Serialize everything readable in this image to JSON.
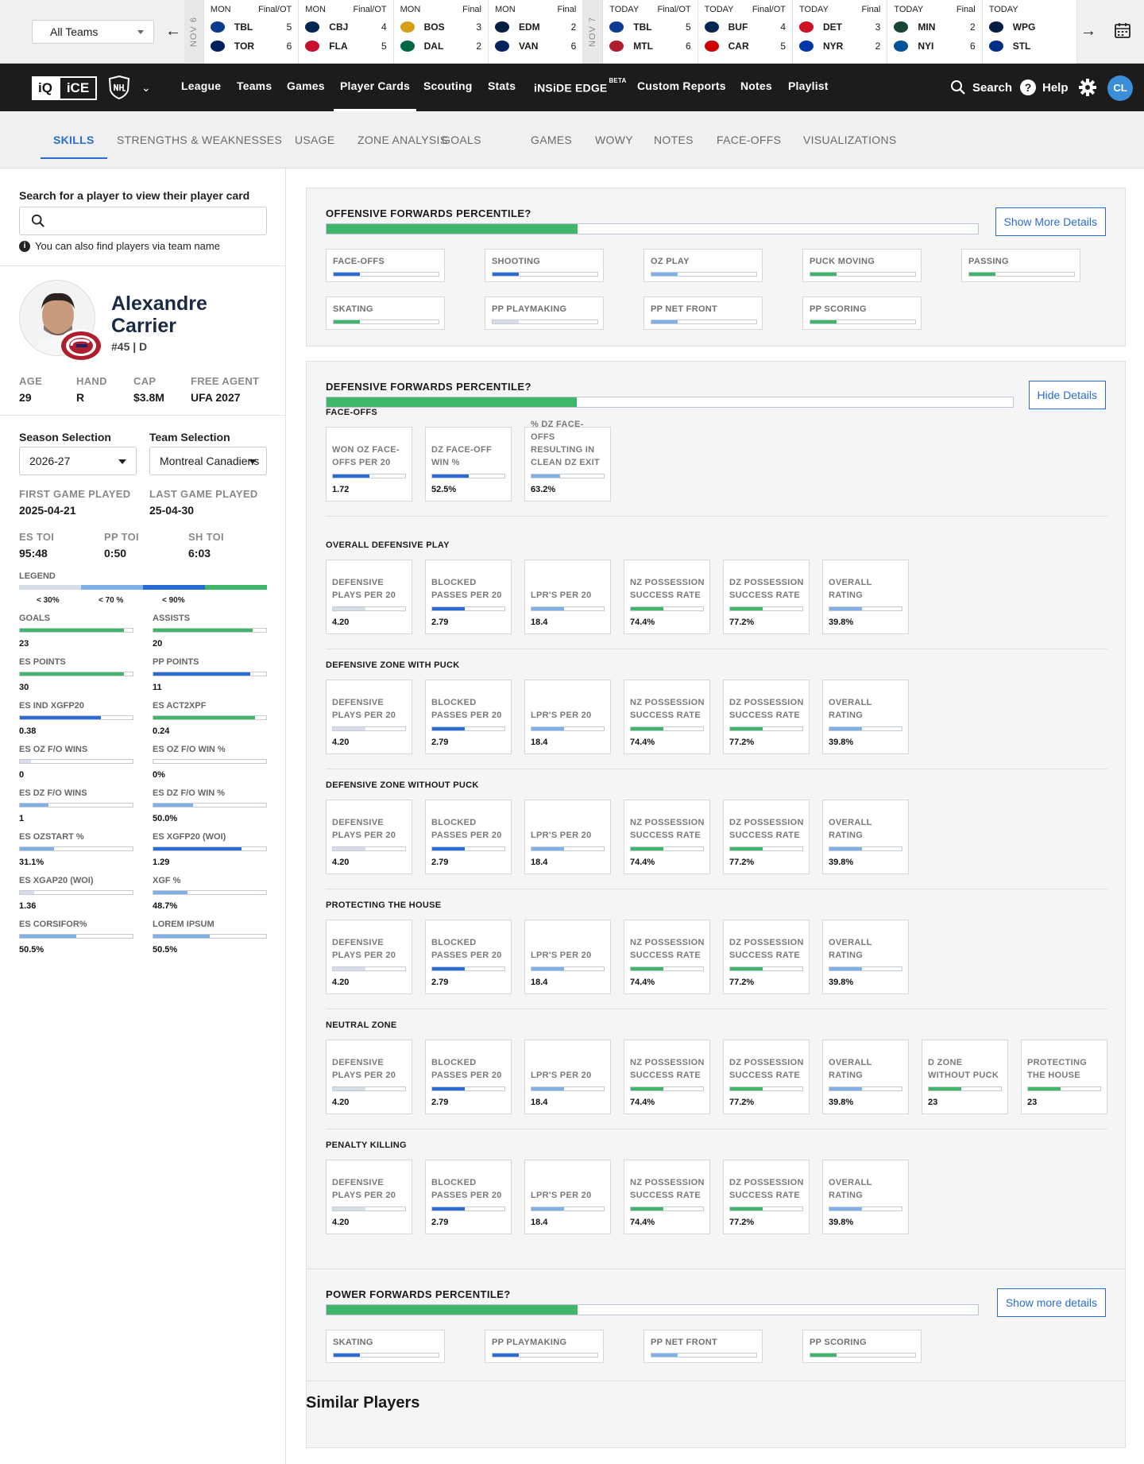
{
  "scoreboard": {
    "team_filter": "All Teams",
    "dates": [
      "NOV 6",
      "NOV 7"
    ],
    "games": [
      {
        "day": "MON",
        "status": "Final/OT",
        "t1": "TBL",
        "s1": "5",
        "t2": "TOR",
        "s2": "6",
        "c1": "#0b3b8c",
        "c2": "#00205b"
      },
      {
        "day": "MON",
        "status": "Final/OT",
        "t1": "CBJ",
        "s1": "4",
        "t2": "FLA",
        "s2": "5",
        "c1": "#002654",
        "c2": "#c8102e"
      },
      {
        "day": "MON",
        "status": "Final",
        "t1": "BOS",
        "s1": "3",
        "t2": "DAL",
        "s2": "2",
        "c1": "#d4a017",
        "c2": "#006847"
      },
      {
        "day": "MON",
        "status": "Final",
        "t1": "EDM",
        "s1": "2",
        "t2": "VAN",
        "s2": "6",
        "c1": "#041e42",
        "c2": "#00205b"
      },
      {
        "day": "TODAY",
        "status": "Final/OT",
        "t1": "TBL",
        "s1": "5",
        "t2": "MTL",
        "s2": "6",
        "c1": "#0b3b8c",
        "c2": "#af1e2d"
      },
      {
        "day": "TODAY",
        "status": "Final/OT",
        "t1": "BUF",
        "s1": "4",
        "t2": "CAR",
        "s2": "5",
        "c1": "#002654",
        "c2": "#cc0000"
      },
      {
        "day": "TODAY",
        "status": "Final",
        "t1": "DET",
        "s1": "3",
        "t2": "NYR",
        "s2": "2",
        "c1": "#ce1126",
        "c2": "#0038a8"
      },
      {
        "day": "TODAY",
        "status": "Final",
        "t1": "MIN",
        "s1": "2",
        "t2": "NYI",
        "s2": "6",
        "c1": "#154734",
        "c2": "#00539b"
      },
      {
        "day": "TODAY",
        "status": "",
        "t1": "WPG",
        "s1": "",
        "t2": "STL",
        "s2": "",
        "c1": "#041e42",
        "c2": "#002f87"
      }
    ]
  },
  "nav": {
    "logo_iq": "iQ",
    "logo_ice": "iCE",
    "items": [
      "League",
      "Teams",
      "Games",
      "Player Cards",
      "Scouting",
      "Stats",
      "iNSiDE EDGE",
      "Custom Reports",
      "Notes",
      "Playlist"
    ],
    "beta": "BETA",
    "search": "Search",
    "help": "Help",
    "avatar": "CL"
  },
  "subtabs": [
    "SKILLS",
    "STRENGTHS & WEAKNESSES",
    "USAGE",
    "ZONE ANALYSIS",
    "GOALS",
    "GAMES",
    "WOWY",
    "NOTES",
    "FACE-OFFS",
    "VISUALIZATIONS"
  ],
  "sidebar": {
    "search_label": "Search for a player to view their player card",
    "search_hint": "You can also find players via team name",
    "player_first": "Alexandre",
    "player_last": "Carrier",
    "number_pos": "#45 | D",
    "bio": [
      {
        "l": "AGE",
        "v": "29"
      },
      {
        "l": "HAND",
        "v": "R"
      },
      {
        "l": "CAP",
        "v": "$3.8M"
      },
      {
        "l": "FREE AGENT",
        "v": "UFA 2027"
      }
    ],
    "season_label": "Season Selection",
    "season": "2026-27",
    "team_label": "Team Selection",
    "team": "Montreal Canadiens",
    "first_label": "FIRST GAME PLAYED",
    "first": "2025-04-21",
    "last_label": "LAST GAME PLAYED",
    "last": "25-04-30",
    "toi": [
      {
        "l": "ES TOI",
        "v": "95:48"
      },
      {
        "l": "PP TOI",
        "v": "0:50"
      },
      {
        "l": "SH TOI",
        "v": "6:03"
      }
    ],
    "legend_label": "LEGEND",
    "legend": [
      "< 30%",
      "< 70 %",
      "< 90%"
    ],
    "stats": [
      {
        "l": "GOALS",
        "v": "23",
        "p": 0.92,
        "c": "#3fb66a"
      },
      {
        "l": "ASSISTS",
        "v": "20",
        "p": 0.88,
        "c": "#3fb66a"
      },
      {
        "l": "ES POINTS",
        "v": "30",
        "p": 0.92,
        "c": "#3fb66a"
      },
      {
        "l": "PP POINTS",
        "v": "11",
        "p": 0.86,
        "c": "#2a6bd4"
      },
      {
        "l": "ES IND XGFP20",
        "v": "0.38",
        "p": 0.72,
        "c": "#2a6bd4"
      },
      {
        "l": "ES ACT2XPF",
        "v": "0.24",
        "p": 0.9,
        "c": "#3fb66a"
      },
      {
        "l": "ES OZ F/O WINS",
        "v": "0",
        "p": 0.1,
        "c": "#d6dde8"
      },
      {
        "l": "ES OZ F/O WIN %",
        "v": "0%",
        "p": 0.0,
        "c": "#d6dde8"
      },
      {
        "l": "ES DZ F/O WINS",
        "v": "1",
        "p": 0.25,
        "c": "#7fb0e8"
      },
      {
        "l": "ES DZ F/O WIN %",
        "v": "50.0%",
        "p": 0.35,
        "c": "#7fb0e8"
      },
      {
        "l": "ES OZSTART %",
        "v": "31.1%",
        "p": 0.3,
        "c": "#7fb0e8"
      },
      {
        "l": "ES XGFP20 (WOI)",
        "v": "1.29",
        "p": 0.78,
        "c": "#2a6bd4"
      },
      {
        "l": "ES XGAP20 (WOI)",
        "v": "1.36",
        "p": 0.13,
        "c": "#d6dde8"
      },
      {
        "l": "XGF %",
        "v": "48.7%",
        "p": 0.3,
        "c": "#7fb0e8"
      },
      {
        "l": "ES CORSIFOR%",
        "v": "50.5%",
        "p": 0.5,
        "c": "#7fb0e8"
      },
      {
        "l": "LOREM IPSUM",
        "v": "50.5%",
        "p": 0.5,
        "c": "#7fb0e8"
      }
    ]
  },
  "panels": {
    "offensive": {
      "title": "OFFENSIVE FORWARDS PERCENTILE?",
      "pct": 0.385,
      "button": "Show More Details",
      "chips": [
        {
          "l": "FACE-OFFS",
          "p": 0.25,
          "c": "#2a6bd4"
        },
        {
          "l": "SHOOTING",
          "p": 0.25,
          "c": "#2a6bd4"
        },
        {
          "l": "OZ PLAY",
          "p": 0.25,
          "c": "#7fb0e8"
        },
        {
          "l": "PUCK MOVING",
          "p": 0.25,
          "c": "#3fb66a"
        },
        {
          "l": "PASSING",
          "p": 0.25,
          "c": "#3fb66a"
        },
        {
          "l": "SKATING",
          "p": 0.25,
          "c": "#3fb66a"
        },
        {
          "l": "PP PLAYMAKING",
          "p": 0.25,
          "c": "#d6dde8"
        },
        {
          "l": "PP NET FRONT",
          "p": 0.25,
          "c": "#7fb0e8"
        },
        {
          "l": "PP SCORING",
          "p": 0.25,
          "c": "#3fb66a"
        }
      ]
    },
    "defensive": {
      "title": "DEFENSIVE FORWARDS PERCENTILE?",
      "pct": 0.365,
      "button": "Hide Details",
      "sections": [
        {
          "title": "FACE-OFFS",
          "cards": [
            {
              "l": "WON OZ FACE-OFFS PER 20",
              "v": "1.72",
              "p": 0.5,
              "c": "#2a6bd4"
            },
            {
              "l": "DZ FACE-OFF WIN %",
              "v": "52.5%",
              "p": 0.5,
              "c": "#2a6bd4"
            },
            {
              "l": "% DZ FACE-OFFS RESULTING IN CLEAN DZ EXIT",
              "v": "63.2%",
              "p": 0.4,
              "c": "#7fb0e8"
            }
          ]
        },
        {
          "title": "OVERALL DEFENSIVE PLAY",
          "cards": [
            {
              "l": "DEFENSIVE PLAYS PER 20",
              "v": "4.20",
              "p": 0.45,
              "c": "#d6dde8"
            },
            {
              "l": "BLOCKED PASSES PER 20",
              "v": "2.79",
              "p": 0.45,
              "c": "#2a6bd4"
            },
            {
              "l": "LPR'S PER 20",
              "v": "18.4",
              "p": 0.45,
              "c": "#7fb0e8"
            },
            {
              "l": "NZ POSSESSION SUCCESS RATE",
              "v": "74.4%",
              "p": 0.45,
              "c": "#3fb66a"
            },
            {
              "l": "DZ POSSESSION SUCCESS RATE",
              "v": "77.2%",
              "p": 0.45,
              "c": "#3fb66a"
            },
            {
              "l": "OVERALL RATING",
              "v": "39.8%",
              "p": 0.45,
              "c": "#7fb0e8"
            }
          ]
        },
        {
          "title": "DEFENSIVE ZONE WITH PUCK",
          "cards": [
            {
              "l": "DEFENSIVE PLAYS PER 20",
              "v": "4.20",
              "p": 0.45,
              "c": "#d6dde8"
            },
            {
              "l": "BLOCKED PASSES PER 20",
              "v": "2.79",
              "p": 0.45,
              "c": "#2a6bd4"
            },
            {
              "l": "LPR'S PER 20",
              "v": "18.4",
              "p": 0.45,
              "c": "#7fb0e8"
            },
            {
              "l": "NZ POSSESSION SUCCESS RATE",
              "v": "74.4%",
              "p": 0.45,
              "c": "#3fb66a"
            },
            {
              "l": "DZ POSSESSION SUCCESS RATE",
              "v": "77.2%",
              "p": 0.45,
              "c": "#3fb66a"
            },
            {
              "l": "OVERALL RATING",
              "v": "39.8%",
              "p": 0.45,
              "c": "#7fb0e8"
            }
          ]
        },
        {
          "title": "DEFENSIVE ZONE WITHOUT PUCK",
          "cards": [
            {
              "l": "DEFENSIVE PLAYS PER 20",
              "v": "4.20",
              "p": 0.45,
              "c": "#d6dde8"
            },
            {
              "l": "BLOCKED PASSES PER 20",
              "v": "2.79",
              "p": 0.45,
              "c": "#2a6bd4"
            },
            {
              "l": "LPR'S PER 20",
              "v": "18.4",
              "p": 0.45,
              "c": "#7fb0e8"
            },
            {
              "l": "NZ POSSESSION SUCCESS RATE",
              "v": "74.4%",
              "p": 0.45,
              "c": "#3fb66a"
            },
            {
              "l": "DZ POSSESSION SUCCESS RATE",
              "v": "77.2%",
              "p": 0.45,
              "c": "#3fb66a"
            },
            {
              "l": "OVERALL RATING",
              "v": "39.8%",
              "p": 0.45,
              "c": "#7fb0e8"
            }
          ]
        },
        {
          "title": "PROTECTING THE HOUSE",
          "cards": [
            {
              "l": "DEFENSIVE PLAYS PER 20",
              "v": "4.20",
              "p": 0.45,
              "c": "#d6dde8"
            },
            {
              "l": "BLOCKED PASSES PER 20",
              "v": "2.79",
              "p": 0.45,
              "c": "#2a6bd4"
            },
            {
              "l": "LPR'S PER 20",
              "v": "18.4",
              "p": 0.45,
              "c": "#7fb0e8"
            },
            {
              "l": "NZ POSSESSION SUCCESS RATE",
              "v": "74.4%",
              "p": 0.45,
              "c": "#3fb66a"
            },
            {
              "l": "DZ POSSESSION SUCCESS RATE",
              "v": "77.2%",
              "p": 0.45,
              "c": "#3fb66a"
            },
            {
              "l": "OVERALL RATING",
              "v": "39.8%",
              "p": 0.45,
              "c": "#7fb0e8"
            }
          ]
        },
        {
          "title": "NEUTRAL ZONE",
          "cards": [
            {
              "l": "DEFENSIVE PLAYS PER 20",
              "v": "4.20",
              "p": 0.45,
              "c": "#d6dde8"
            },
            {
              "l": "BLOCKED PASSES PER 20",
              "v": "2.79",
              "p": 0.45,
              "c": "#2a6bd4"
            },
            {
              "l": "LPR'S PER 20",
              "v": "18.4",
              "p": 0.45,
              "c": "#7fb0e8"
            },
            {
              "l": "NZ POSSESSION SUCCESS RATE",
              "v": "74.4%",
              "p": 0.45,
              "c": "#3fb66a"
            },
            {
              "l": "DZ POSSESSION SUCCESS RATE",
              "v": "77.2%",
              "p": 0.45,
              "c": "#3fb66a"
            },
            {
              "l": "OVERALL RATING",
              "v": "39.8%",
              "p": 0.45,
              "c": "#7fb0e8"
            },
            {
              "l": "D ZONE WITHOUT PUCK",
              "v": "23",
              "p": 0.45,
              "c": "#3fb66a"
            },
            {
              "l": "PROTECTING THE HOUSE",
              "v": "23",
              "p": 0.45,
              "c": "#3fb66a"
            }
          ]
        },
        {
          "title": "PENALTY KILLING",
          "cards": [
            {
              "l": "DEFENSIVE PLAYS PER 20",
              "v": "4.20",
              "p": 0.45,
              "c": "#d6dde8"
            },
            {
              "l": "BLOCKED PASSES PER 20",
              "v": "2.79",
              "p": 0.45,
              "c": "#2a6bd4"
            },
            {
              "l": "LPR'S PER 20",
              "v": "18.4",
              "p": 0.45,
              "c": "#7fb0e8"
            },
            {
              "l": "NZ POSSESSION SUCCESS RATE",
              "v": "74.4%",
              "p": 0.45,
              "c": "#3fb66a"
            },
            {
              "l": "DZ POSSESSION SUCCESS RATE",
              "v": "77.2%",
              "p": 0.45,
              "c": "#3fb66a"
            },
            {
              "l": "OVERALL RATING",
              "v": "39.8%",
              "p": 0.45,
              "c": "#7fb0e8"
            }
          ]
        }
      ]
    },
    "power": {
      "title": "POWER FORWARDS PERCENTILE?",
      "pct": 0.385,
      "button": "Show more details",
      "chips": [
        {
          "l": "SKATING",
          "p": 0.25,
          "c": "#2a6bd4"
        },
        {
          "l": "PP PLAYMAKING",
          "p": 0.25,
          "c": "#2a6bd4"
        },
        {
          "l": "PP NET FRONT",
          "p": 0.25,
          "c": "#7fb0e8"
        },
        {
          "l": "PP SCORING",
          "p": 0.25,
          "c": "#3fb66a"
        }
      ]
    }
  },
  "similar_title": "Similar Players"
}
